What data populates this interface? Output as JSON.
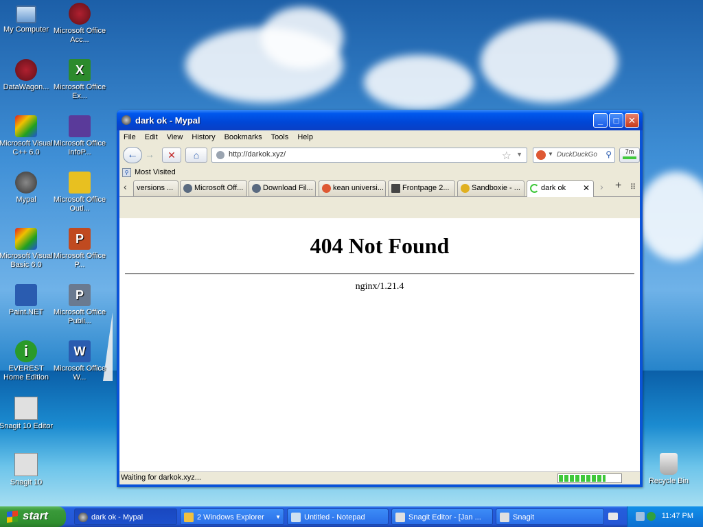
{
  "desktop": {
    "icons": [
      {
        "label": "My Computer",
        "icon": "computer-icon"
      },
      {
        "label": "Microsoft Office Acc...",
        "icon": "access-icon"
      },
      {
        "label": "DataWagon...",
        "icon": "datawagon-icon"
      },
      {
        "label": "Microsoft Office Ex...",
        "icon": "excel-icon"
      },
      {
        "label": "Microsoft Visual C++ 6.0",
        "icon": "visual-cpp-icon"
      },
      {
        "label": "Microsoft Office InfoP...",
        "icon": "infopath-icon"
      },
      {
        "label": "Mypal",
        "icon": "mypal-icon"
      },
      {
        "label": "Microsoft Office Outl...",
        "icon": "outlook-icon"
      },
      {
        "label": "Microsoft Visual Basic 6.0",
        "icon": "visual-basic-icon"
      },
      {
        "label": "Microsoft Office P...",
        "icon": "powerpoint-icon"
      },
      {
        "label": "Paint.NET",
        "icon": "paintnet-icon"
      },
      {
        "label": "Microsoft Office Publi...",
        "icon": "publisher-icon"
      },
      {
        "label": "EVEREST Home Edition",
        "icon": "everest-icon"
      },
      {
        "label": "Microsoft Office W...",
        "icon": "word-icon"
      },
      {
        "label": "Snagit 10 Editor",
        "icon": "snagit-editor-icon"
      },
      {
        "label": "Snagit 10",
        "icon": "snagit-icon"
      },
      {
        "label": "Recycle Bin",
        "icon": "recycle-bin-icon"
      }
    ]
  },
  "window": {
    "title": "dark ok - Mypal",
    "menu": [
      "File",
      "Edit",
      "View",
      "History",
      "Bookmarks",
      "Tools",
      "Help"
    ],
    "url": "http://darkok.xyz/",
    "search_placeholder": "DuckDuckGo",
    "download_label": "7m",
    "bookmark": "Most Visited",
    "tabs": [
      {
        "label": "versions ...",
        "icon": "page-icon"
      },
      {
        "label": "Microsoft Off...",
        "icon": "wordpress-icon"
      },
      {
        "label": "Download Fil...",
        "icon": "wordpress-icon"
      },
      {
        "label": "kean universi...",
        "icon": "duckduckgo-icon"
      },
      {
        "label": "Frontpage 2...",
        "icon": "building-icon"
      },
      {
        "label": "Sandboxie - ...",
        "icon": "sandboxie-icon"
      },
      {
        "label": "dark ok",
        "icon": "loading-icon",
        "active": true
      }
    ],
    "page": {
      "heading": "404 Not Found",
      "server": "nginx/1.21.4"
    },
    "status": "Waiting for darkok.xyz...",
    "progress": 0.75
  },
  "taskbar": {
    "start": "start",
    "tasks": [
      {
        "label": "dark ok - Mypal",
        "active": true
      },
      {
        "label": "2 Windows Explorer",
        "active": false
      },
      {
        "label": "Untitled - Notepad",
        "active": false
      },
      {
        "label": "Snagit Editor - [Jan ...",
        "active": false
      },
      {
        "label": "Snagit",
        "active": false
      }
    ],
    "clock": "11:47 PM"
  },
  "colors": {
    "titlebar": "#0058ee",
    "start_green": "#3a9a3a",
    "progress_green": "#3fc83a"
  }
}
